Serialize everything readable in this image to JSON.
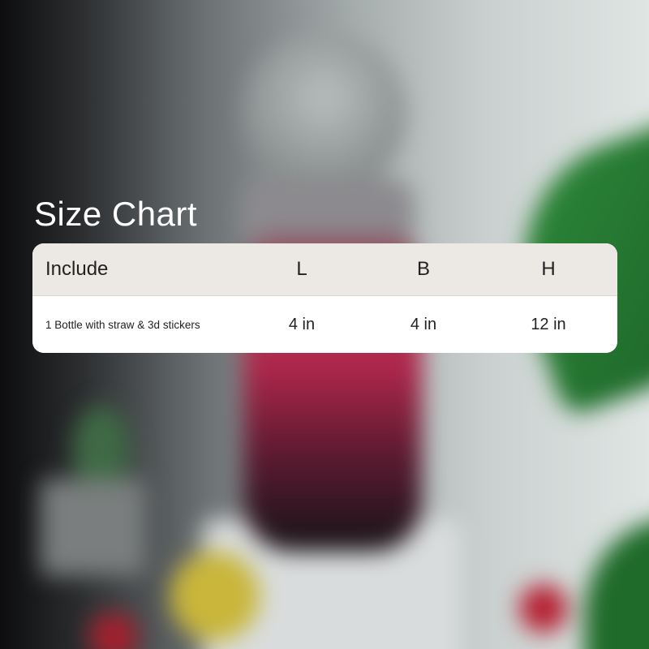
{
  "title": "Size Chart",
  "table": {
    "headers": [
      "Include",
      "L",
      "B",
      "H"
    ],
    "rows": [
      [
        "1 Bottle with straw & 3d stickers",
        "4 in",
        "4 in",
        "12 in"
      ]
    ]
  }
}
